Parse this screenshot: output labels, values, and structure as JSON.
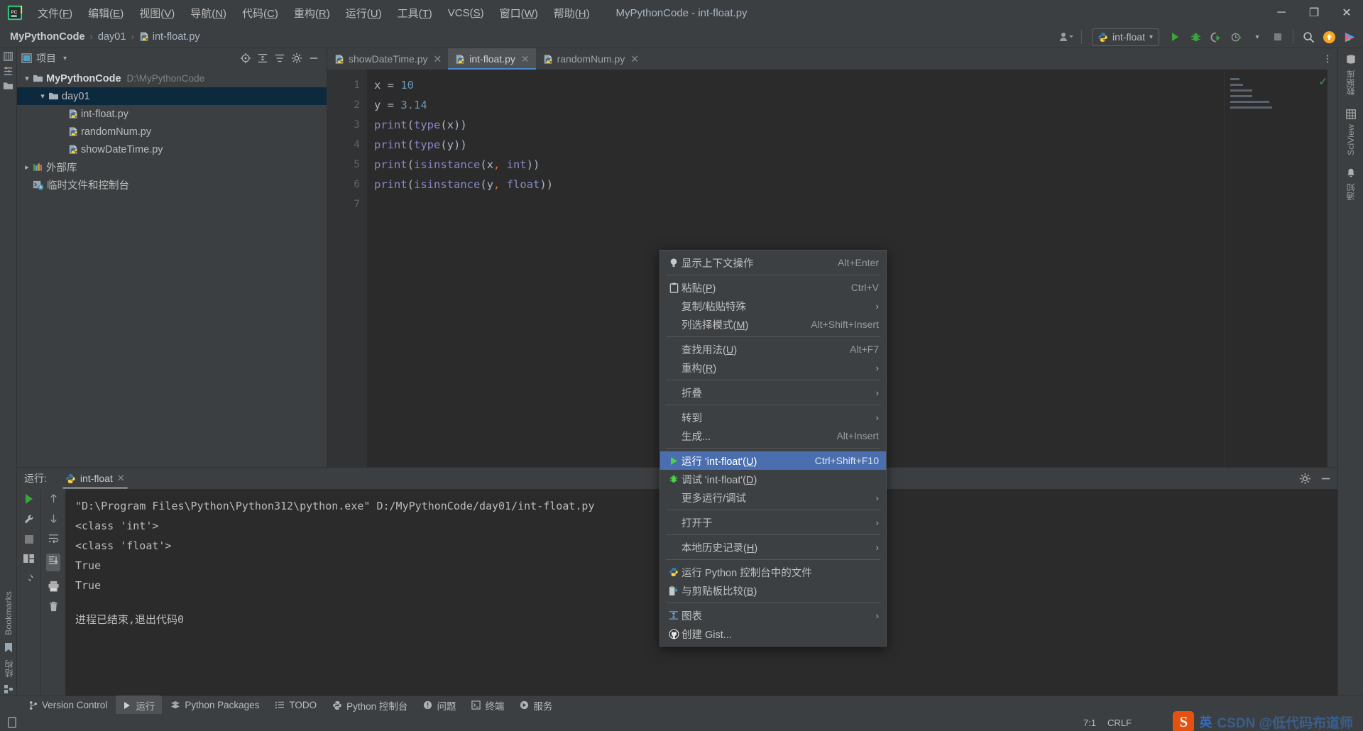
{
  "window": {
    "title": "MyPythonCode - int-float.py",
    "minimize": "─",
    "maximize": "❐",
    "close": "✕"
  },
  "menubar": [
    {
      "label": "文件(F)",
      "name": "menu-file"
    },
    {
      "label": "编辑(E)",
      "name": "menu-edit"
    },
    {
      "label": "视图(V)",
      "name": "menu-view"
    },
    {
      "label": "导航(N)",
      "name": "menu-navigate"
    },
    {
      "label": "代码(C)",
      "name": "menu-code"
    },
    {
      "label": "重构(R)",
      "name": "menu-refactor"
    },
    {
      "label": "运行(U)",
      "name": "menu-run"
    },
    {
      "label": "工具(T)",
      "name": "menu-tools"
    },
    {
      "label": "VCS(S)",
      "name": "menu-vcs"
    },
    {
      "label": "窗口(W)",
      "name": "menu-window"
    },
    {
      "label": "帮助(H)",
      "name": "menu-help"
    }
  ],
  "breadcrumb": {
    "project": "MyPythonCode",
    "folder": "day01",
    "file": "int-float.py",
    "separator": "›"
  },
  "toolbar": {
    "run_config": "int-float",
    "chevron": "▾"
  },
  "project_panel": {
    "title": "项目",
    "chevron": "▾",
    "tree": [
      {
        "label": "MyPythonCode",
        "sub": "D:\\MyPythonCode",
        "level": 0,
        "type": "folder",
        "expanded": true,
        "selected": false,
        "name": "tree-node-mypythoncode"
      },
      {
        "label": "day01",
        "sub": "",
        "level": 1,
        "type": "folder",
        "expanded": true,
        "selected": true,
        "name": "tree-node-day01"
      },
      {
        "label": "int-float.py",
        "sub": "",
        "level": 2,
        "type": "python",
        "expanded": null,
        "selected": false,
        "name": "tree-node-int-float"
      },
      {
        "label": "randomNum.py",
        "sub": "",
        "level": 2,
        "type": "python",
        "expanded": null,
        "selected": false,
        "name": "tree-node-randomnum"
      },
      {
        "label": "showDateTime.py",
        "sub": "",
        "level": 2,
        "type": "python",
        "expanded": null,
        "selected": false,
        "name": "tree-node-showdatetime"
      },
      {
        "label": "外部库",
        "sub": "",
        "level": 0,
        "type": "lib",
        "expanded": false,
        "selected": false,
        "name": "tree-node-external-libraries"
      },
      {
        "label": "临时文件和控制台",
        "sub": "",
        "level": 0,
        "type": "scratch",
        "expanded": null,
        "selected": false,
        "name": "tree-node-scratches"
      }
    ]
  },
  "editor_tabs": [
    {
      "label": "showDateTime.py",
      "active": false,
      "name": "editor-tab-showdatetime"
    },
    {
      "label": "int-float.py",
      "active": true,
      "name": "editor-tab-int-float"
    },
    {
      "label": "randomNum.py",
      "active": false,
      "name": "editor-tab-randomnum"
    }
  ],
  "editor": {
    "line_numbers": [
      "1",
      "2",
      "3",
      "4",
      "5",
      "6",
      "7"
    ],
    "lines": [
      "x = 10",
      "y = 3.14",
      "print(type(x))",
      "print(type(y))",
      "print(isinstance(x, int))",
      "print(isinstance(y, float))",
      ""
    ]
  },
  "context_menu": [
    {
      "type": "item",
      "icon": "lightbulb-icon",
      "label": "显示上下文操作",
      "shortcut": "Alt+Enter",
      "arrow": false,
      "highlighted": false,
      "name": "ctx-show-context-actions"
    },
    {
      "type": "sep"
    },
    {
      "type": "item",
      "icon": "clipboard-icon",
      "label": "粘贴(P)",
      "mnemonic": "P",
      "shortcut": "Ctrl+V",
      "arrow": false,
      "highlighted": false,
      "name": "ctx-paste"
    },
    {
      "type": "item",
      "icon": "",
      "label": "复制/粘贴特殊",
      "shortcut": "",
      "arrow": true,
      "highlighted": false,
      "name": "ctx-copy-paste-special"
    },
    {
      "type": "item",
      "icon": "",
      "label": "列选择模式(M)",
      "mnemonic": "M",
      "shortcut": "Alt+Shift+Insert",
      "arrow": false,
      "highlighted": false,
      "name": "ctx-column-selection-mode"
    },
    {
      "type": "sep"
    },
    {
      "type": "item",
      "icon": "",
      "label": "查找用法(U)",
      "mnemonic": "U",
      "shortcut": "Alt+F7",
      "arrow": false,
      "highlighted": false,
      "name": "ctx-find-usages"
    },
    {
      "type": "item",
      "icon": "",
      "label": "重构(R)",
      "mnemonic": "R",
      "shortcut": "",
      "arrow": true,
      "highlighted": false,
      "name": "ctx-refactor"
    },
    {
      "type": "sep"
    },
    {
      "type": "item",
      "icon": "",
      "label": "折叠",
      "shortcut": "",
      "arrow": true,
      "highlighted": false,
      "name": "ctx-folding"
    },
    {
      "type": "sep"
    },
    {
      "type": "item",
      "icon": "",
      "label": "转到",
      "shortcut": "",
      "arrow": true,
      "highlighted": false,
      "name": "ctx-go-to"
    },
    {
      "type": "item",
      "icon": "",
      "label": "生成...",
      "shortcut": "Alt+Insert",
      "arrow": false,
      "highlighted": false,
      "name": "ctx-generate"
    },
    {
      "type": "sep"
    },
    {
      "type": "item",
      "icon": "run-green-triangle-icon",
      "label": "运行 'int-float'(U)",
      "mnemonic": "U",
      "shortcut": "Ctrl+Shift+F10",
      "arrow": false,
      "highlighted": true,
      "name": "ctx-run-int-float"
    },
    {
      "type": "item",
      "icon": "debug-bug-icon",
      "label": "调试 'int-float'(D)",
      "mnemonic": "D",
      "shortcut": "",
      "arrow": false,
      "highlighted": false,
      "name": "ctx-debug-int-float"
    },
    {
      "type": "item",
      "icon": "",
      "label": "更多运行/调试",
      "shortcut": "",
      "arrow": true,
      "highlighted": false,
      "name": "ctx-more-run-debug"
    },
    {
      "type": "sep"
    },
    {
      "type": "item",
      "icon": "",
      "label": "打开于",
      "shortcut": "",
      "arrow": true,
      "highlighted": false,
      "name": "ctx-open-in"
    },
    {
      "type": "sep"
    },
    {
      "type": "item",
      "icon": "",
      "label": "本地历史记录(H)",
      "mnemonic": "H",
      "shortcut": "",
      "arrow": true,
      "highlighted": false,
      "name": "ctx-local-history"
    },
    {
      "type": "sep"
    },
    {
      "type": "item",
      "icon": "python-icon",
      "label": "运行 Python 控制台中的文件",
      "shortcut": "",
      "arrow": false,
      "highlighted": false,
      "name": "ctx-run-file-in-python-console"
    },
    {
      "type": "item",
      "icon": "compare-clipboard-icon",
      "label": "与剪贴板比较(B)",
      "mnemonic": "B",
      "shortcut": "",
      "arrow": false,
      "highlighted": false,
      "name": "ctx-compare-with-clipboard"
    },
    {
      "type": "sep"
    },
    {
      "type": "item",
      "icon": "diagram-icon",
      "label": "图表",
      "shortcut": "",
      "arrow": true,
      "highlighted": false,
      "name": "ctx-diagrams"
    },
    {
      "type": "item",
      "icon": "github-icon",
      "label": "创建 Gist...",
      "shortcut": "",
      "arrow": false,
      "highlighted": false,
      "name": "ctx-create-gist"
    }
  ],
  "run_panel": {
    "label": "运行:",
    "tab": "int-float",
    "close": "✕",
    "console_lines": [
      "\"D:\\Program Files\\Python\\Python312\\python.exe\" D:/MyPythonCode/day01/int-float.py",
      "<class 'int'>",
      "<class 'float'>",
      "True",
      "True",
      "",
      "进程已结束,退出代码0"
    ]
  },
  "left_rail": {
    "bookmarks_label": "Bookmarks",
    "structure_label": "结构"
  },
  "right_rail": [
    {
      "label": "数据库",
      "icon": "database-icon",
      "name": "right-rail-database"
    },
    {
      "label": "SciView",
      "icon": "grid-icon",
      "name": "right-rail-sciview"
    },
    {
      "label": "通知",
      "icon": "bell-icon",
      "name": "right-rail-notifications"
    }
  ],
  "bottom_bar": [
    {
      "label": "Version Control",
      "icon": "branch-icon",
      "active": false,
      "name": "bottom-tab-version-control"
    },
    {
      "label": "运行",
      "icon": "run-icon",
      "active": true,
      "name": "bottom-tab-run"
    },
    {
      "label": "Python Packages",
      "icon": "packages-icon",
      "active": false,
      "name": "bottom-tab-python-packages"
    },
    {
      "label": "TODO",
      "icon": "todo-icon",
      "active": false,
      "name": "bottom-tab-todo"
    },
    {
      "label": "Python 控制台",
      "icon": "python-icon",
      "active": false,
      "name": "bottom-tab-python-console"
    },
    {
      "label": "问题",
      "icon": "problems-icon",
      "active": false,
      "name": "bottom-tab-problems"
    },
    {
      "label": "终端",
      "icon": "terminal-icon",
      "active": false,
      "name": "bottom-tab-terminal"
    },
    {
      "label": "服务",
      "icon": "services-icon",
      "active": false,
      "name": "bottom-tab-services"
    }
  ],
  "status_bar": {
    "caret": "7:1",
    "line_ending": "CRLF",
    "ime": "英",
    "watermark": "CSDN @低代码布道师",
    "sogou": "S"
  }
}
